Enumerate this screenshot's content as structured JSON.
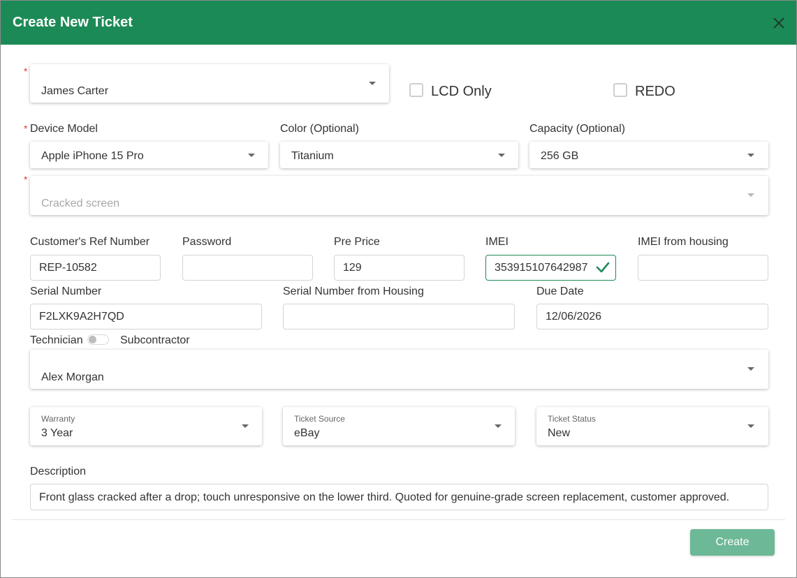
{
  "dialog": {
    "title": "Create New Ticket",
    "close_icon": "close-icon",
    "accent_color": "#1c8a56"
  },
  "customer": {
    "value": "James Carter"
  },
  "checkboxes": {
    "lcd_only": {
      "label": "LCD Only",
      "checked": false
    },
    "redo": {
      "label": "REDO",
      "checked": false
    }
  },
  "device_model": {
    "label": "Device Model",
    "value": "Apple iPhone 15 Pro"
  },
  "color": {
    "label": "Color (Optional)",
    "value": "Titanium"
  },
  "capacity": {
    "label": "Capacity (Optional)",
    "value": "256 GB"
  },
  "issue": {
    "placeholder": "Cracked screen"
  },
  "fields": {
    "customer_ref": {
      "label": "Customer's Ref Number",
      "value": "REP-10582"
    },
    "password": {
      "label": "Password",
      "value": ""
    },
    "pre_price": {
      "label": "Pre Price",
      "value": "129"
    },
    "imei": {
      "label": "IMEI",
      "value": "353915107642987",
      "status_icon": "checkmark-icon"
    },
    "imei_housing": {
      "label": "IMEI from housing",
      "value": ""
    },
    "serial": {
      "label": "Serial Number",
      "value": "F2LXK9A2H7QD"
    },
    "serial_housing": {
      "label": "Serial Number from Housing",
      "value": ""
    },
    "due_date": {
      "label": "Due Date",
      "value": "12/06/2026"
    }
  },
  "assignee_toggle": {
    "left_label": "Technician",
    "right_label": "Subcontractor",
    "on": false
  },
  "technician": {
    "value": "Alex Morgan"
  },
  "warranty": {
    "label": "Warranty",
    "value": "3 Year"
  },
  "ticket_source": {
    "label": "Ticket Source",
    "value": "eBay"
  },
  "ticket_status": {
    "label": "Ticket Status",
    "value": "New"
  },
  "description": {
    "label": "Description",
    "value": "Front glass cracked after a drop; touch unresponsive on the lower third. Quoted for genuine-grade screen replacement, customer approved."
  },
  "footer": {
    "create_label": "Create"
  }
}
